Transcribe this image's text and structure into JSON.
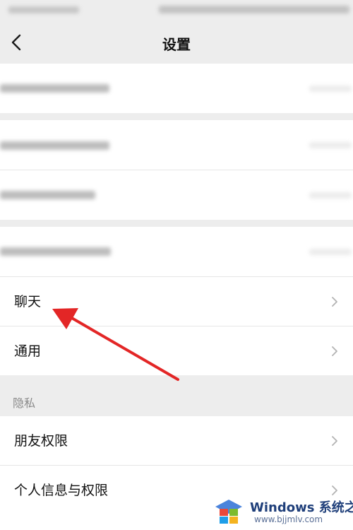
{
  "header": {
    "title": "设置"
  },
  "menu": {
    "chat_label": "聊天",
    "general_label": "通用"
  },
  "privacy": {
    "section_label": "隐私",
    "friends_label": "朋友权限",
    "personal_label": "个人信息与权限"
  },
  "watermark": {
    "title": "Windows 系统之家",
    "url": "www.bjjmlv.com"
  },
  "colors": {
    "annotation_arrow": "#e32626",
    "background": "#ededed",
    "cell": "#ffffff",
    "chevron": "#b2b2b2"
  }
}
